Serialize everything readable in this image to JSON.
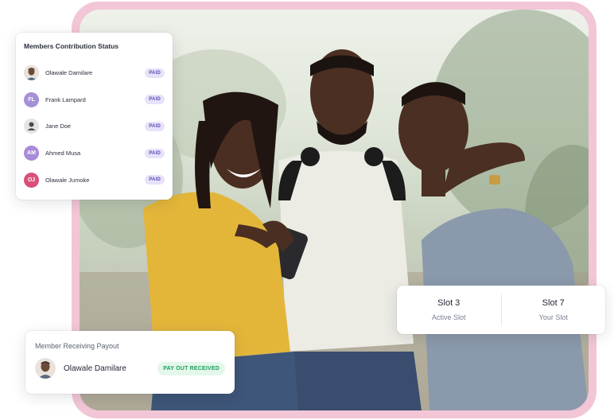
{
  "members_card": {
    "title": "Members Contribution Status",
    "members": [
      {
        "name": "Olawale Damilare",
        "avatar_type": "photo",
        "status": "PAID"
      },
      {
        "name": "Frank Lampard",
        "initials": "FL",
        "avatar_color": "#a690d8",
        "status": "PAID"
      },
      {
        "name": "Jane Doe",
        "avatar_type": "placeholder",
        "status": "PAID"
      },
      {
        "name": "Ahmed Musa",
        "initials": "AM",
        "avatar_color": "#a98bd9",
        "status": "PAID"
      },
      {
        "name": "Olawale Jumoke",
        "initials": "OJ",
        "avatar_color": "#d9507a",
        "status": "PAID"
      }
    ]
  },
  "slot_card": {
    "active_slot_value": "Slot 3",
    "active_slot_label": "Active Slot",
    "your_slot_value": "Slot 7",
    "your_slot_label": "Your Slot"
  },
  "payout_card": {
    "title": "Member Receiving Payout",
    "member_name": "Olawale Damilare",
    "status": "PAY OUT RECEIVED"
  },
  "colors": {
    "frame_pink": "#f2c6d6",
    "paid_badge_bg": "#e6e2fa",
    "paid_badge_text": "#5b4fb3",
    "received_badge_bg": "#e3f7ea",
    "received_badge_text": "#1f9d5a"
  }
}
